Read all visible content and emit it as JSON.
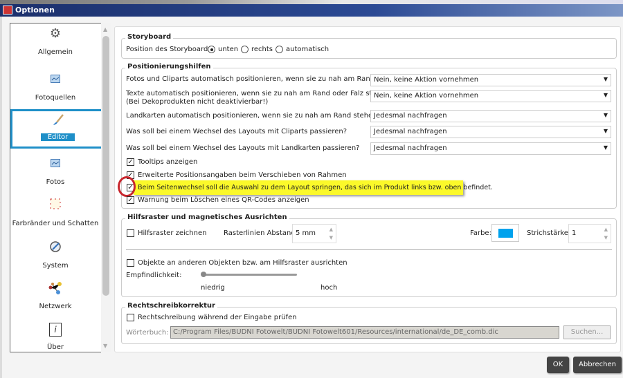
{
  "window": {
    "title": "Optionen"
  },
  "sidebar": {
    "items": [
      {
        "label": "Allgemein",
        "icon": "gear-icon"
      },
      {
        "label": "Fotoquellen",
        "icon": "image-icon"
      },
      {
        "label": "Editor",
        "icon": "brush-icon"
      },
      {
        "label": "Fotos",
        "icon": "image-icon"
      },
      {
        "label": "Farbränder und Schatten",
        "icon": "frame-icon"
      },
      {
        "label": "System",
        "icon": "system-icon"
      },
      {
        "label": "Netzwerk",
        "icon": "network-icon"
      },
      {
        "label": "Über",
        "icon": "info-icon"
      }
    ],
    "selected": "Editor"
  },
  "storyboard": {
    "title": "Storyboard",
    "label": "Position des Storyboards:",
    "options": [
      "unten",
      "rechts",
      "automatisch"
    ],
    "selected": "unten"
  },
  "positionierung": {
    "title": "Positionierungshilfen",
    "rows": [
      {
        "label": "Fotos und Cliparts automatisch positionieren, wenn sie zu nah am Rand stehen?",
        "value": "Nein, keine Aktion vornehmen"
      },
      {
        "label": "Texte automatisch positionieren, wenn sie zu nah am Rand oder Falz stehen?",
        "label2": "(Bei Dekoprodukten nicht deaktivierbar!)",
        "value": "Nein, keine Aktion vornehmen"
      },
      {
        "label": "Landkarten automatisch positionieren, wenn sie zu nah am Rand stehen?",
        "value": "Jedesmal nachfragen"
      },
      {
        "label": "Was soll bei einem Wechsel des Layouts mit Cliparts passieren?",
        "value": "Jedesmal nachfragen"
      },
      {
        "label": "Was soll bei einem Wechsel des Layouts mit Landkarten passieren?",
        "value": "Jedesmal nachfragen"
      }
    ],
    "checks": [
      {
        "label": "Tooltips anzeigen",
        "checked": true
      },
      {
        "label": "Erweiterte Positionsangaben beim Verschieben von Rahmen",
        "checked": true
      },
      {
        "label": "Beim Seitenwechsel soll die Auswahl zu dem Layout springen, das sich im Produkt links bzw. oben befindet.",
        "checked": true
      },
      {
        "label": "Warnung beim Löschen eines QR-Codes anzeigen",
        "checked": true
      }
    ]
  },
  "hilfsraster": {
    "title": "Hilfsraster und magnetisches Ausrichten",
    "draw_label": "Hilfsraster zeichnen",
    "spacing_label": "Rasterlinien Abstand:",
    "spacing_value": "5 mm",
    "color_label": "Farbe:",
    "color": "#00a2ed",
    "stroke_label": "Strichstärke:",
    "stroke_value": "1",
    "snap_label": "Objekte an anderen Objekten bzw. am Hilfsraster ausrichten",
    "sens_label": "Empfindlichkeit:",
    "sens_min": "niedrig",
    "sens_max": "hoch",
    "sens_value": 0
  },
  "rechtschreib": {
    "title": "Rechtschreibkorrektur",
    "check_label": "Rechtschreibung während der Eingabe prüfen",
    "dict_label": "Wörterbuch:",
    "dict_value": "C:/Program Files/BUDNI Fotowelt/BUDNI Fotowelt601/Resources/international/de_DE_comb.dic",
    "search_label": "Suchen..."
  },
  "footer": {
    "ok": "OK",
    "cancel": "Abbrechen"
  }
}
